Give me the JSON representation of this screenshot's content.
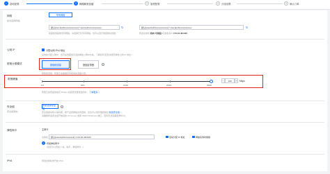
{
  "steps": [
    {
      "num": "✓",
      "label": "基础配置"
    },
    {
      "num": "2",
      "label": "网络和安全组"
    },
    {
      "num": "3",
      "label": "管理配置"
    },
    {
      "num": "4",
      "label": "分组设置"
    },
    {
      "num": "5",
      "label": "确认订单"
    }
  ],
  "network": {
    "label": "网络",
    "sublabel": "如何选择网络",
    "type_button": "专有网络",
    "vpc_value": "默认[vpc-bp1fxxxxxxxxxxxxx] / vpc-bp1fxxxxxxxxxxxx",
    "vswitch_value": "默认[vsw-bp1fxxxxxxxxxxxx] / vsw-bp1fxxxxxxxxxxxx",
    "refresh": "↻",
    "note_left": "如需使用其他专有网络，请选择已有专有网络，也可以自行到控制台创建。",
    "note_right_prefix": "所选交换机",
    "note_right_zone": "杭州 可用区I",
    "note_right_cidr": "172.16.48.0/20",
    "note_right_avail": "可用私有IP"
  },
  "public_ip": {
    "label": "公网 IP",
    "checkbox_label": "分配公网 IPv4 地址",
    "note": "系统将分配公网IP，也可采用更加灵活的弹性公网IP方案，了解如何 配置并绑定弹性公网 IP 地址 >"
  },
  "billing": {
    "label": "带宽计费模式",
    "options": [
      "按使用流量",
      "按固定带宽"
    ],
    "note": "按使用流量：阿里云会根据实际使用的流量计费。"
  },
  "bandwidth": {
    "label": "带宽峰值",
    "ticks": [
      "1M",
      "50M",
      "100M",
      "200M",
      "300M"
    ],
    "value": "100",
    "unit": "Mbps",
    "minus": "−",
    "plus": "+",
    "note": "阿里云免费提供最高 5Gbps 的恶意流量攻击防护，",
    "note_link": "了解更多 >"
  },
  "security_group": {
    "label": "安全组",
    "sublabel": "安全组限制",
    "button": "重新选择安全组",
    "note": "安全组类似防火墙功能，用于设置网络访问控制，您也可以到管理控制台",
    "note_link": "新建安全组 >",
    "note2": "请确保所选安全组开放包含 22 (Linux) 或者 3389 (Windows) 端口，否则无法远程登录ECS。"
  },
  "eni": {
    "label": "弹性网卡",
    "header": "主网卡",
    "net_label": "交换机",
    "net_value": "默认[vsw-bp1fxxxxxxxxx] / 172.16.48.0/20",
    "opt1": "自动分配 IP 地址",
    "opt2": "释放实例时保留",
    "add_label": "增加弹性网卡",
    "add_note": "(您还可以增加 1 块，提示，弹性网卡...)"
  },
  "ipv6": {
    "label": "IPv6",
    "note": "所选交换机未开启 IPv6"
  },
  "colors": {
    "accent": "#0a6cff",
    "highlight": "#e2231a"
  }
}
